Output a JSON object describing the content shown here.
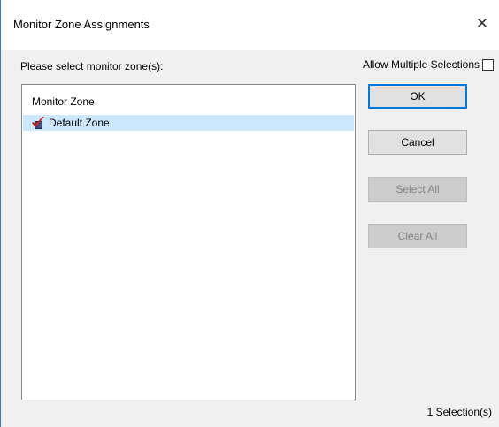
{
  "window": {
    "title": "Monitor Zone Assignments",
    "close_label": "✕"
  },
  "prompt": "Please select monitor zone(s):",
  "allow_multiple": {
    "label": "Allow Multiple Selections",
    "checked": false
  },
  "list": {
    "header": "Monitor Zone",
    "items": [
      {
        "label": "Default Zone",
        "icon": "zone-check-icon",
        "selected": true
      }
    ]
  },
  "buttons": {
    "ok": "OK",
    "cancel": "Cancel",
    "select_all": "Select All",
    "clear_all": "Clear All"
  },
  "status": "1 Selection(s)",
  "colors": {
    "selection": "#cce8ff",
    "accent": "#0078d7",
    "dialog_bg": "#f0f0f0"
  }
}
